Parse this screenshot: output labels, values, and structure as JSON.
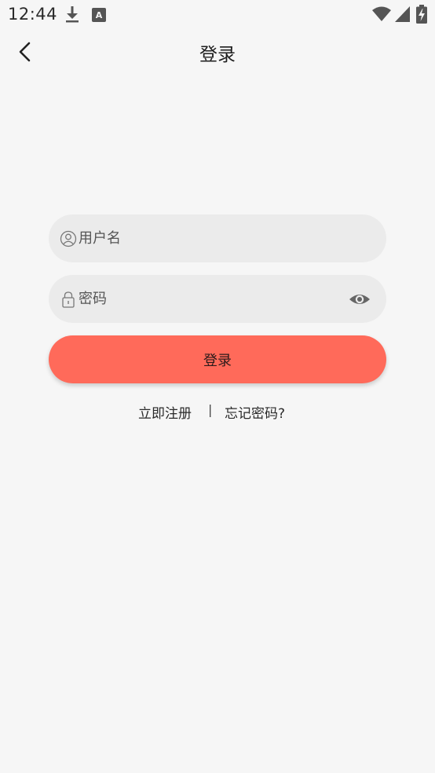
{
  "status_bar": {
    "time": "12:44",
    "icons": [
      "download-icon",
      "accessibility-a-icon",
      "wifi-icon",
      "signal-icon",
      "battery-charging-icon"
    ]
  },
  "app_bar": {
    "title": "登录",
    "back_icon": "chevron-left-icon"
  },
  "form": {
    "username": {
      "placeholder": "用户名",
      "value": "",
      "icon": "user-icon"
    },
    "password": {
      "placeholder": "密码",
      "value": "",
      "icon": "lock-icon",
      "toggle_icon": "eye-icon"
    },
    "login_label": "登录"
  },
  "links": {
    "register": "立即注册",
    "separator": "|",
    "forgot": "忘记密码?"
  },
  "colors": {
    "background": "#f6f6f6",
    "field_background": "#ebebeb",
    "accent": "#ff6a5a"
  }
}
